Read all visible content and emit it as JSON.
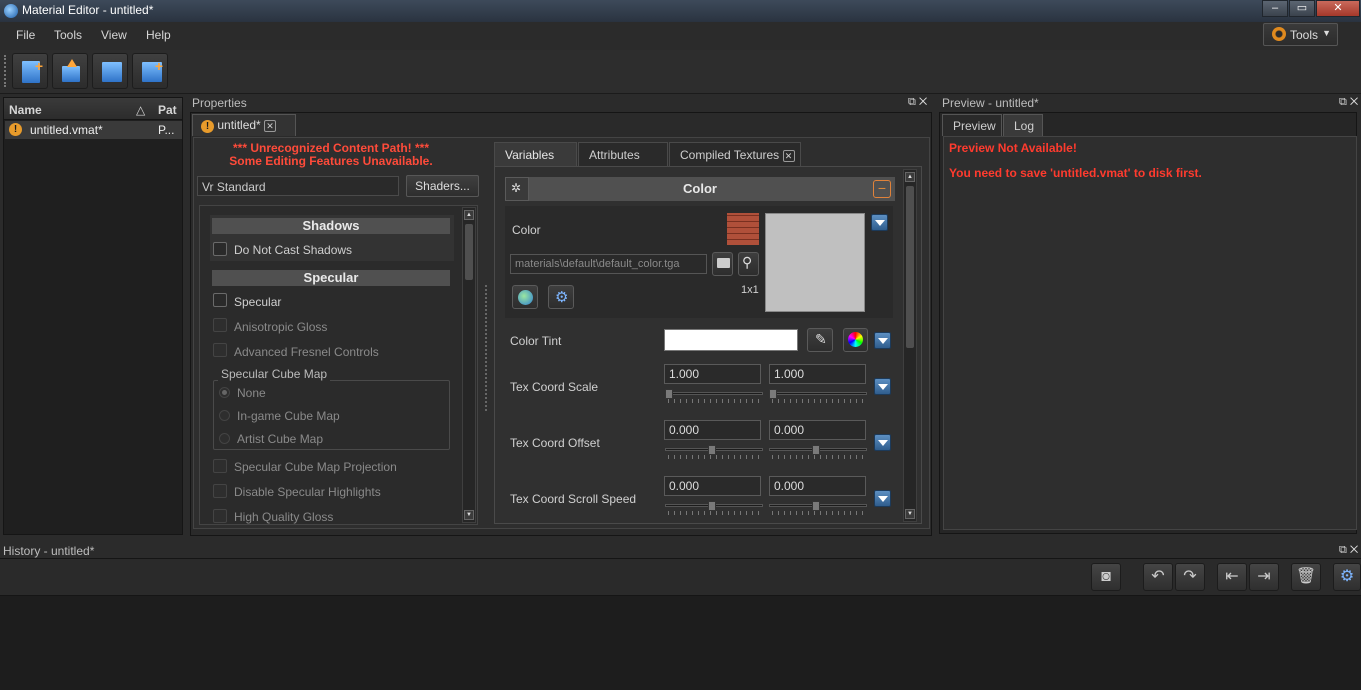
{
  "window": {
    "title": "Material Editor - untitled*",
    "min": "–",
    "max": "▭",
    "close": "✕"
  },
  "menu": {
    "file": "File",
    "tools": "Tools",
    "view": "View",
    "help": "Help",
    "tools_dropdown": "Tools"
  },
  "files": {
    "col_name": "Name",
    "col_sort": "△",
    "col_path": "Pat",
    "items": [
      {
        "name": "untitled.vmat*",
        "path": "P..."
      }
    ]
  },
  "properties": {
    "title": "Properties",
    "doc_tab": "untitled*",
    "warning_line1": "*** Unrecognized Content Path! ***",
    "warning_line2": "Some Editing Features Unavailable.",
    "shader_value": "Vr Standard",
    "shaders_button": "Shaders...",
    "sections": {
      "shadows": "Shadows",
      "specular": "Specular"
    },
    "checkboxes": {
      "do_not_cast_shadows": "Do Not Cast Shadows",
      "specular": "Specular",
      "anisotropic_gloss": "Anisotropic Gloss",
      "advanced_fresnel": "Advanced Fresnel Controls",
      "cube_projection": "Specular Cube Map Projection",
      "disable_highlights": "Disable Specular Highlights",
      "high_quality_gloss": "High Quality Gloss"
    },
    "cube_map": {
      "title": "Specular Cube Map",
      "none": "None",
      "ingame": "In-game Cube Map",
      "artist": "Artist Cube Map"
    },
    "tabs": {
      "variables": "Variables",
      "attributes": "Attributes",
      "compiled": "Compiled Textures"
    },
    "color_section": "Color",
    "color_label": "Color",
    "color_path": "materials\\default\\default_color.tga",
    "color_size": "1x1",
    "tint_label": "Color Tint",
    "scale_label": "Tex Coord Scale",
    "scale_x": "1.000",
    "scale_y": "1.000",
    "offset_label": "Tex Coord Offset",
    "offset_x": "0.000",
    "offset_y": "0.000",
    "scroll_label": "Tex Coord Scroll Speed",
    "scroll_x": "0.000",
    "scroll_y": "0.000"
  },
  "preview": {
    "title": "Preview - untitled*",
    "tab_preview": "Preview",
    "tab_log": "Log",
    "log_line1": "Preview Not Available!",
    "log_line2": "You need to save 'untitled.vmat' to disk first."
  },
  "history": {
    "title": "History - untitled*"
  },
  "colors": {
    "warning": "#ff3b2e",
    "accent": "#e08a1e",
    "tint": "#ffffff",
    "swatch": "#c0c0c0"
  }
}
